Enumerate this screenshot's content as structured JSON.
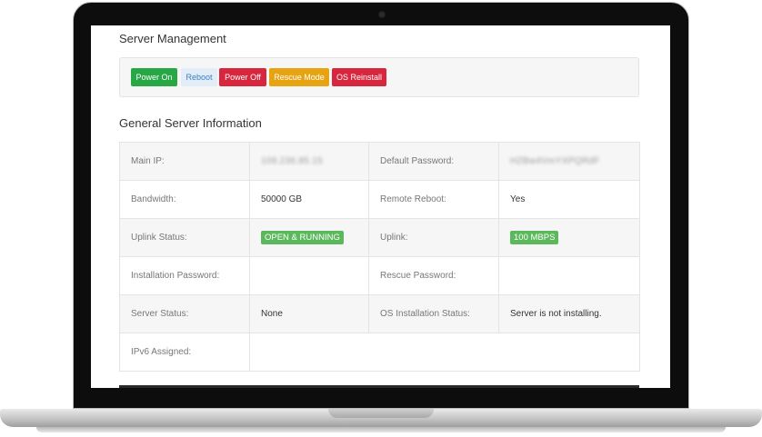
{
  "server_management": {
    "title": "Server Management",
    "buttons": {
      "power_on": "Power On",
      "reboot": "Reboot",
      "power_off": "Power Off",
      "rescue_mode": "Rescue Mode",
      "os_reinstall": "OS Reinstall"
    }
  },
  "general_info": {
    "title": "General Server Information",
    "rows": [
      {
        "label1": "Main IP:",
        "value1": "109.236.85.15",
        "label2": "Default Password:",
        "value2": "HZBw4VmYXPQRdF"
      },
      {
        "label1": "Bandwidth:",
        "value1": "50000 GB",
        "label2": "Remote Reboot:",
        "value2": "Yes"
      },
      {
        "label1": "Uplink Status:",
        "value1": "OPEN & RUNNING",
        "label2": "Uplink:",
        "value2": "100 MBPS"
      },
      {
        "label1": "Installation Password:",
        "value1": "",
        "label2": "Rescue Password:",
        "value2": ""
      },
      {
        "label1": "Server Status:",
        "value1": "None",
        "label2": "OS Installation Status:",
        "value2": "Server is not installing."
      },
      {
        "label1": "IPv6 Assigned:",
        "value1": ""
      }
    ]
  },
  "colors": {
    "success": "#27a845",
    "info_light": "#e3edf7",
    "danger": "#d7263d",
    "warning": "#e8a311",
    "badge_green": "#5cb85c"
  }
}
